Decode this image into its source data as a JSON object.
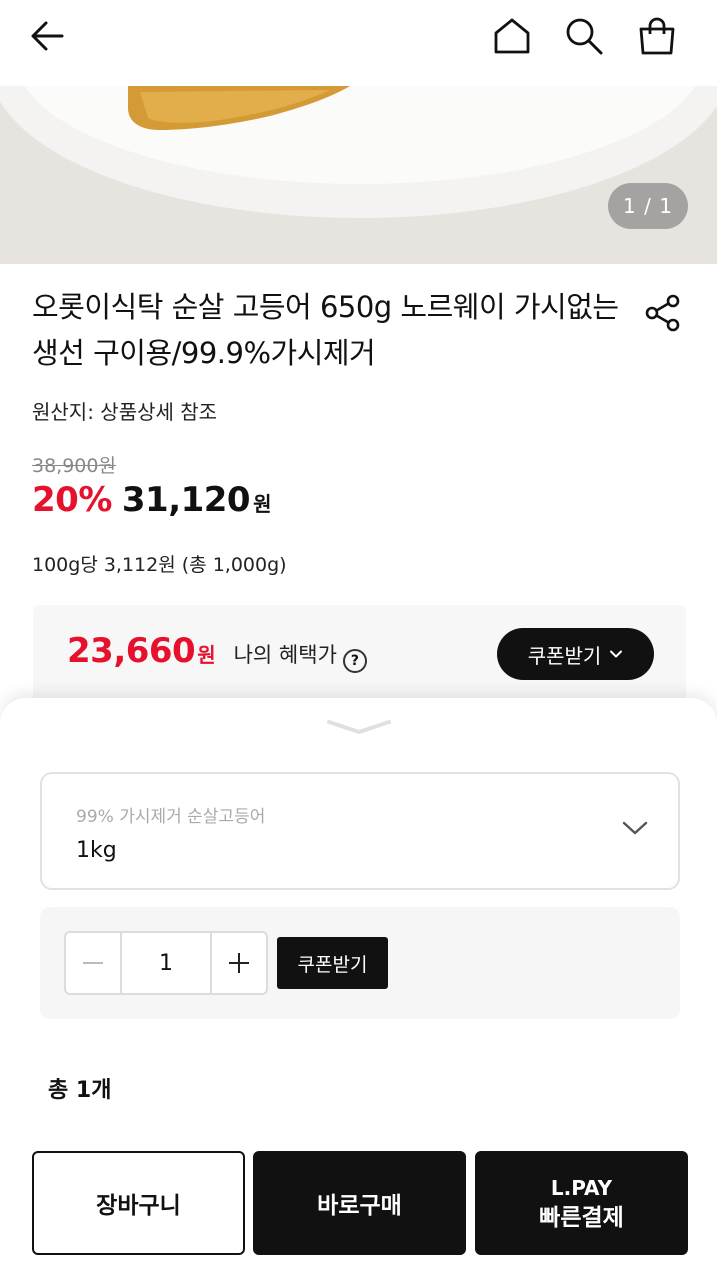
{
  "header": {
    "back_icon": "arrow-left-icon",
    "home_icon": "home-icon",
    "search_icon": "search-icon",
    "cart_icon": "shopping-bag-icon"
  },
  "gallery": {
    "counter": "1 / 1"
  },
  "product": {
    "title": "오롯이식탁 순살 고등어 650g 노르웨이 가시없는 생선 구이용/99.9%가시제거",
    "origin": "원산지: 상품상세 참조",
    "original_price": "38,900원",
    "discount_rate": "20%",
    "sale_price": "31,120",
    "currency": "원",
    "unit_price": "100g당 3,112원 (총 1,000g)"
  },
  "benefit": {
    "price": "23,660",
    "currency": "원",
    "label": "나의 혜택가",
    "help_icon": "?",
    "coupon_button": "쿠폰받기"
  },
  "option_sheet": {
    "option_label": "99% 가시제거 순살고등어",
    "option_value": "1kg",
    "quantity": "1",
    "coupon_button": "쿠폰받기",
    "total": "총 1개"
  },
  "actions": {
    "cart": "장바구니",
    "buy_now": "바로구매",
    "lpay_line1": "L.PAY",
    "lpay_line2": "빠른결제"
  },
  "colors": {
    "accent_red": "#e5112d",
    "dark": "#111111"
  }
}
